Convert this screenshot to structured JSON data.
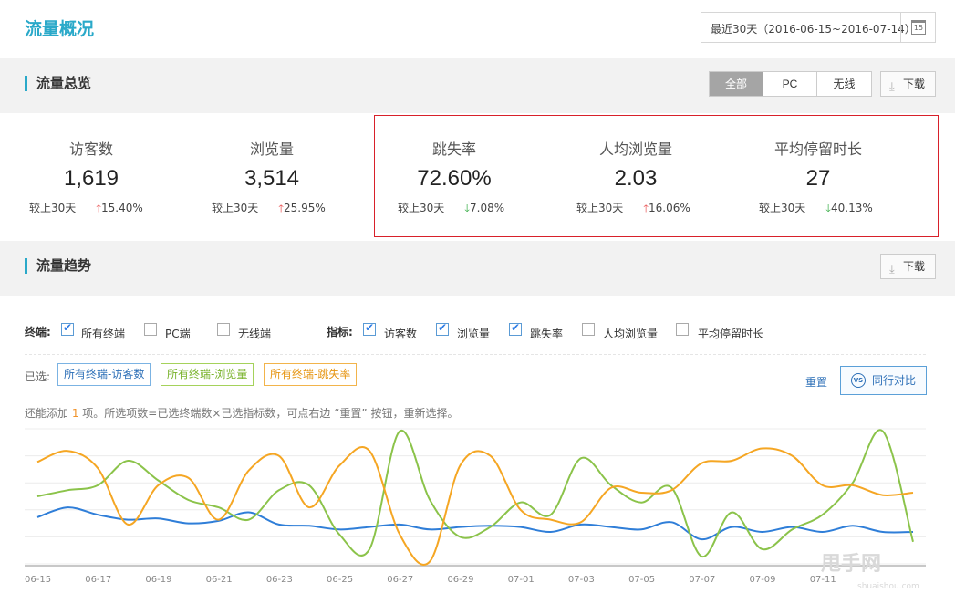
{
  "header": {
    "title": "流量概况",
    "date_range": "最近30天（2016-06-15~2016-07-14）",
    "calendar_icon_text": "15"
  },
  "overview": {
    "title": "流量总览",
    "segments": [
      "全部",
      "PC",
      "无线"
    ],
    "active_segment": "全部",
    "download_label": "下载"
  },
  "kpis": [
    {
      "label": "访客数",
      "value": "1,619",
      "compare_label": "较上30天",
      "direction": "up",
      "change": "15.40%"
    },
    {
      "label": "浏览量",
      "value": "3,514",
      "compare_label": "较上30天",
      "direction": "up",
      "change": "25.95%"
    },
    {
      "label": "跳失率",
      "value": "72.60%",
      "compare_label": "较上30天",
      "direction": "down",
      "change": "7.08%"
    },
    {
      "label": "人均浏览量",
      "value": "2.03",
      "compare_label": "较上30天",
      "direction": "up",
      "change": "16.06%"
    },
    {
      "label": "平均停留时长",
      "value": "27",
      "compare_label": "较上30天",
      "direction": "down",
      "change": "40.13%"
    }
  ],
  "trend": {
    "title": "流量趋势",
    "download_label": "下载",
    "terminal_label": "终端:",
    "terminals": [
      {
        "label": "所有终端",
        "checked": true
      },
      {
        "label": "PC端",
        "checked": false
      },
      {
        "label": "无线端",
        "checked": false
      }
    ],
    "metric_label": "指标:",
    "metrics": [
      {
        "label": "访客数",
        "checked": true
      },
      {
        "label": "浏览量",
        "checked": true
      },
      {
        "label": "跳失率",
        "checked": true
      },
      {
        "label": "人均浏览量",
        "checked": false
      },
      {
        "label": "平均停留时长",
        "checked": false
      }
    ],
    "selected_label": "已选:",
    "selected_chips": [
      {
        "label": "所有终端-访客数",
        "color": "blue"
      },
      {
        "label": "所有终端-浏览量",
        "color": "green"
      },
      {
        "label": "所有终端-跳失率",
        "color": "orange"
      }
    ],
    "reset_label": "重置",
    "compare_label": "同行对比",
    "compare_icon_text": "VS",
    "hint_prefix": "还能添加 ",
    "hint_count": "1",
    "hint_suffix": " 项。所选项数=已选终端数×已选指标数，可点右边 “重置” 按钮，重新选择。"
  },
  "chart_data": {
    "type": "line",
    "x": [
      "06-15",
      "06-16",
      "06-17",
      "06-18",
      "06-19",
      "06-20",
      "06-21",
      "06-22",
      "06-23",
      "06-24",
      "06-25",
      "06-26",
      "06-27",
      "06-28",
      "06-29",
      "06-30",
      "07-01",
      "07-02",
      "07-03",
      "07-04",
      "07-05",
      "07-06",
      "07-07",
      "07-08",
      "07-09",
      "07-10",
      "07-11",
      "07-12",
      "07-13",
      "07-14"
    ],
    "tick_labels": [
      "06-15",
      "06-17",
      "06-19",
      "06-21",
      "06-23",
      "06-25",
      "06-27",
      "06-29",
      "07-01",
      "07-03",
      "07-05",
      "07-07",
      "07-09",
      "07-11"
    ],
    "series": [
      {
        "name": "所有终端-访客数",
        "color": "#2f7ed8",
        "values": [
          0.38,
          0.46,
          0.4,
          0.36,
          0.37,
          0.33,
          0.35,
          0.42,
          0.32,
          0.31,
          0.28,
          0.3,
          0.32,
          0.28,
          0.3,
          0.31,
          0.3,
          0.26,
          0.32,
          0.3,
          0.28,
          0.34,
          0.2,
          0.3,
          0.26,
          0.3,
          0.26,
          0.31,
          0.26,
          0.26
        ]
      },
      {
        "name": "所有终端-浏览量",
        "color": "#8bc34a",
        "values": [
          0.55,
          0.6,
          0.64,
          0.84,
          0.68,
          0.52,
          0.46,
          0.36,
          0.6,
          0.64,
          0.24,
          0.12,
          1.08,
          0.52,
          0.22,
          0.3,
          0.5,
          0.4,
          0.86,
          0.64,
          0.5,
          0.62,
          0.06,
          0.42,
          0.12,
          0.28,
          0.4,
          0.66,
          1.08,
          0.18
        ]
      },
      {
        "name": "所有终端-跳失率",
        "color": "#f5a623",
        "values": [
          0.83,
          0.92,
          0.78,
          0.32,
          0.64,
          0.7,
          0.36,
          0.76,
          0.88,
          0.46,
          0.8,
          0.92,
          0.24,
          0.02,
          0.8,
          0.88,
          0.44,
          0.36,
          0.34,
          0.62,
          0.58,
          0.6,
          0.82,
          0.84,
          0.94,
          0.88,
          0.64,
          0.64,
          0.56,
          0.58
        ]
      }
    ],
    "ylim": [
      0,
      1.1
    ],
    "grid": true,
    "legend": "none"
  },
  "watermark": {
    "text": "甩手网",
    "sub": "shuaishou.com"
  }
}
